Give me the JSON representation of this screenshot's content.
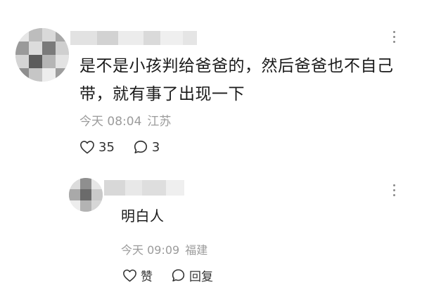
{
  "comment": {
    "text_line1": "是不是小孩判给爸爸的，然后爸爸也不自己",
    "text_line2": "带，就有事了出现一下",
    "time": "今天 08:04",
    "location": "江苏",
    "like_count": "35",
    "reply_count": "3",
    "icons": [
      "more-icon",
      "heart-icon",
      "comment-icon"
    ]
  },
  "reply": {
    "text": "明白人",
    "time": "今天 09:09",
    "location": "福建",
    "like_label": "赞",
    "reply_label": "回复",
    "icons": [
      "more-icon",
      "heart-icon",
      "comment-icon"
    ]
  },
  "colors": {
    "text": "#1a1a1a",
    "meta": "#9b9b9b",
    "icon": "#333333"
  }
}
